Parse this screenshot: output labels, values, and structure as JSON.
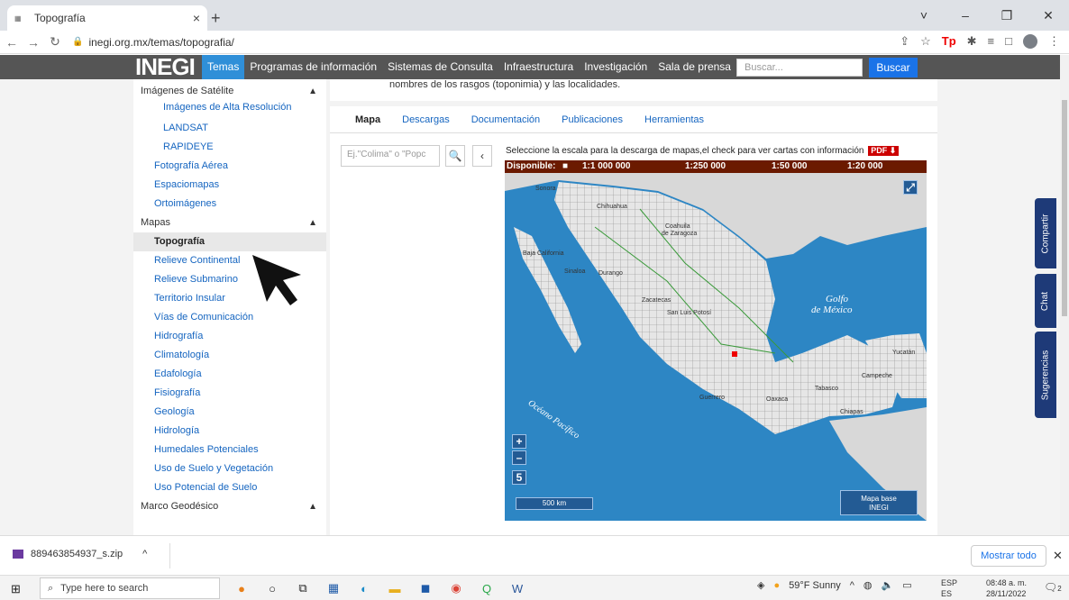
{
  "browser": {
    "tab_title": "Topografía",
    "tab_favicon": "INEGI favicon",
    "url": "inegi.org.mx/temas/topografia/",
    "window_controls": [
      "˅",
      "–",
      "❐",
      "✕"
    ]
  },
  "site_nav": {
    "logo": "INEGI",
    "items": [
      "Temas",
      "Programas de información",
      "Sistemas de Consulta",
      "Infraestructura",
      "Investigación",
      "Sala de prensa"
    ],
    "search_placeholder": "Buscar...",
    "search_button": "Buscar"
  },
  "sidebar": {
    "sections": [
      {
        "label": "Imágenes de Satélite",
        "subitems": [
          "Imágenes de Alta Resolución",
          "LANDSAT",
          "RAPIDEYE"
        ],
        "items": [
          "Fotografía Aérea",
          "Espaciomapas",
          "Ortoimágenes"
        ]
      },
      {
        "label": "Mapas",
        "items": [
          "Topografía",
          "Relieve Continental",
          "Relieve Submarino",
          "Territorio Insular",
          "Vías de Comunicación",
          "Hidrografía",
          "Climatología",
          "Edafología",
          "Fisiografía",
          "Geología",
          "Hidrología",
          "Humedales Potenciales",
          "Uso de Suelo y Vegetación",
          "Uso Potencial de Suelo"
        ]
      },
      {
        "label": "Marco Geodésico",
        "items": []
      }
    ],
    "selected": "Topografía"
  },
  "content": {
    "intro_text": "nombres de los rasgos (toponimia) y las localidades.",
    "tabs": [
      "Mapa",
      "Descargas",
      "Documentación",
      "Publicaciones",
      "Herramientas"
    ],
    "active_tab": "Mapa",
    "map_search_placeholder": "Ej.\"Colima\" o \"Popc",
    "instructions": "Seleccione la escala para la descarga de mapas,el check para ver cartas con información",
    "pdf_label": "PDF",
    "disponible_label": "Disponible:",
    "scales": [
      "1:1 000 000",
      "1:250 000",
      "1:50 000",
      "1:20 000"
    ],
    "map_labels": {
      "golfo_1": "Golfo",
      "golfo_2": "de México",
      "pacifico": "Océano Pacífico",
      "sonora": "Sonora",
      "chihuahua": "Chihuahua",
      "coahuila_1": "Coahuila",
      "coahuila_2": "de Zaragoza",
      "baja_california": "Baja California",
      "sinaloa": "Sinaloa",
      "durango": "Durango",
      "zacatecas": "Zacatecas",
      "san_luis": "San Luis Potosí",
      "guerrero": "Guerrero",
      "oaxaca": "Oaxaca",
      "chiapas": "Chiapas",
      "campeche": "Campeche",
      "tabasco": "Tabasco",
      "yucatan": "Yucatán"
    },
    "zoom_in": "+",
    "zoom_out": "–",
    "layer_count": "5",
    "scale_bar": "500 km",
    "basemap_1": "Mapa base",
    "basemap_2": "INEGI"
  },
  "right_tabs": [
    "Compartir",
    "Chat",
    "Sugerencias"
  ],
  "downloads": {
    "file": "889463854937_s.zip",
    "show_all": "Mostrar todo"
  },
  "taskbar": {
    "search_placeholder": "Type here to search",
    "weather": "59°F Sunny",
    "lang_1": "ESP",
    "lang_2": "ES",
    "time": "08:48 a. m.",
    "date": "28/11/2022",
    "notif_count": "2"
  }
}
